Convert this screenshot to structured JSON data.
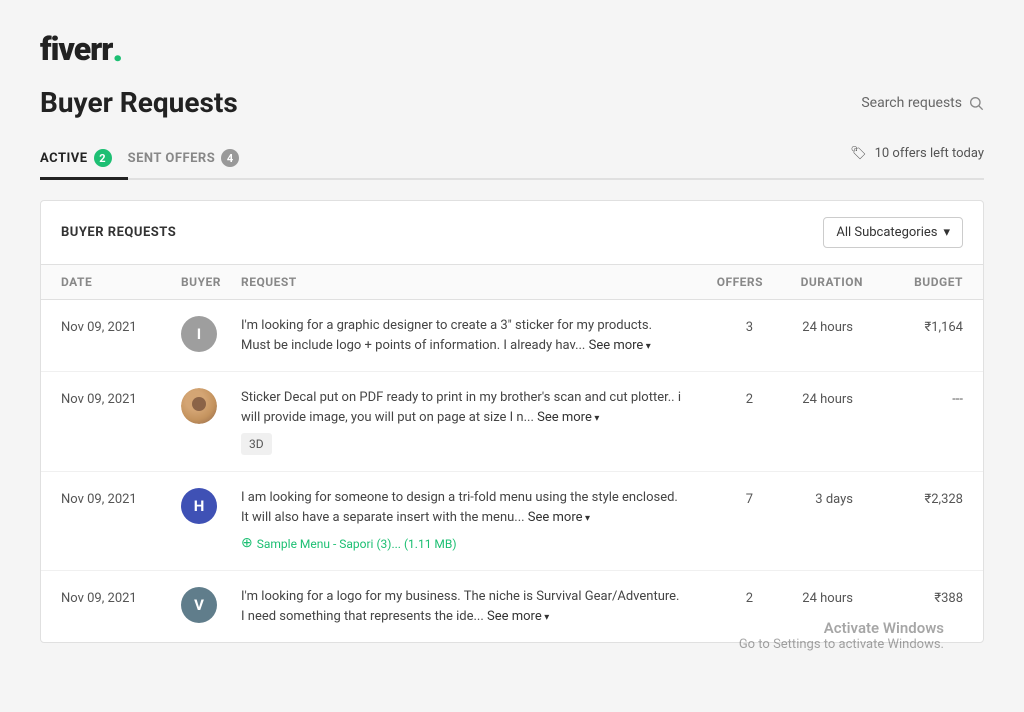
{
  "logo": {
    "text": "fiverr",
    "dot": "."
  },
  "header": {
    "title": "Buyer Requests",
    "search_placeholder": "Search requests"
  },
  "tabs": [
    {
      "id": "active",
      "label": "ACTIVE",
      "badge": "2",
      "active": true,
      "badge_color": "green"
    },
    {
      "id": "sent_offers",
      "label": "SENT OFFERS",
      "badge": "4",
      "active": false,
      "badge_color": "grey"
    }
  ],
  "offers_left": {
    "icon": "🏷",
    "text": "10 offers left today"
  },
  "table": {
    "title": "BUYER REQUESTS",
    "subcategory_label": "All Subcategories",
    "columns": [
      "DATE",
      "BUYER",
      "REQUEST",
      "OFFERS",
      "DURATION",
      "BUDGET"
    ],
    "rows": [
      {
        "date": "Nov 09, 2021",
        "buyer_initial": "I",
        "buyer_color": "#9e9e9e",
        "request": "I'm looking for a graphic designer to create a 3\" sticker for my products. Must be include logo + points of information. I already hav...",
        "see_more": "See more",
        "tag": null,
        "attachment": null,
        "offers": "3",
        "duration": "24 hours",
        "budget": "₹1,164"
      },
      {
        "date": "Nov 09, 2021",
        "buyer_initial": null,
        "buyer_color": null,
        "buyer_photo": true,
        "request": "Sticker Decal put on PDF ready to print in my brother's scan and cut plotter.. i will provide image, you will put on page at size I n...",
        "see_more": "See more",
        "tag": "3D",
        "attachment": null,
        "offers": "2",
        "duration": "24 hours",
        "budget": "---"
      },
      {
        "date": "Nov 09, 2021",
        "buyer_initial": "H",
        "buyer_color": "#3f51b5",
        "request": "I am looking for someone to design a tri-fold menu using the style enclosed. It will also have a separate insert with the menu...",
        "see_more": "See more",
        "tag": null,
        "attachment": "Sample Menu - Sapori (3)...  (1.11 MB)",
        "offers": "7",
        "duration": "3 days",
        "budget": "₹2,328"
      },
      {
        "date": "Nov 09, 2021",
        "buyer_initial": "V",
        "buyer_color": "#607d8b",
        "request": "I'm looking for a logo for my business. The niche is Survival Gear/Adventure. I need something that represents the ide...",
        "see_more": "See more",
        "tag": null,
        "attachment": null,
        "offers": "2",
        "duration": "24 hours",
        "budget": "₹388"
      }
    ]
  },
  "activation": {
    "title": "Activate Windows",
    "subtitle": "Go to Settings to activate Windows."
  }
}
